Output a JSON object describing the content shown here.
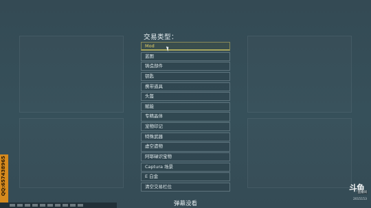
{
  "dropdown": {
    "title": "交易类型：",
    "items": [
      "Mod",
      "蓝图",
      "铸造部件",
      "钥匙",
      "携带道具",
      "头盔",
      "赋能",
      "专精晶体",
      "宠物印记",
      "特殊武器",
      "虚空遗物",
      "阿耶碌识宝物",
      "Captura 场景",
      "E 白金",
      "清空交易栏位"
    ],
    "selected_index": 0
  },
  "caption": "弹幕没看",
  "watermark": "QQ:657438965",
  "logo": {
    "mark": "斗鱼",
    "sub": "直播间",
    "room": "2015153"
  },
  "colors": {
    "background": "#354b55",
    "selected_text": "#e8d36a",
    "watermark_bg": "#d68a1e"
  }
}
